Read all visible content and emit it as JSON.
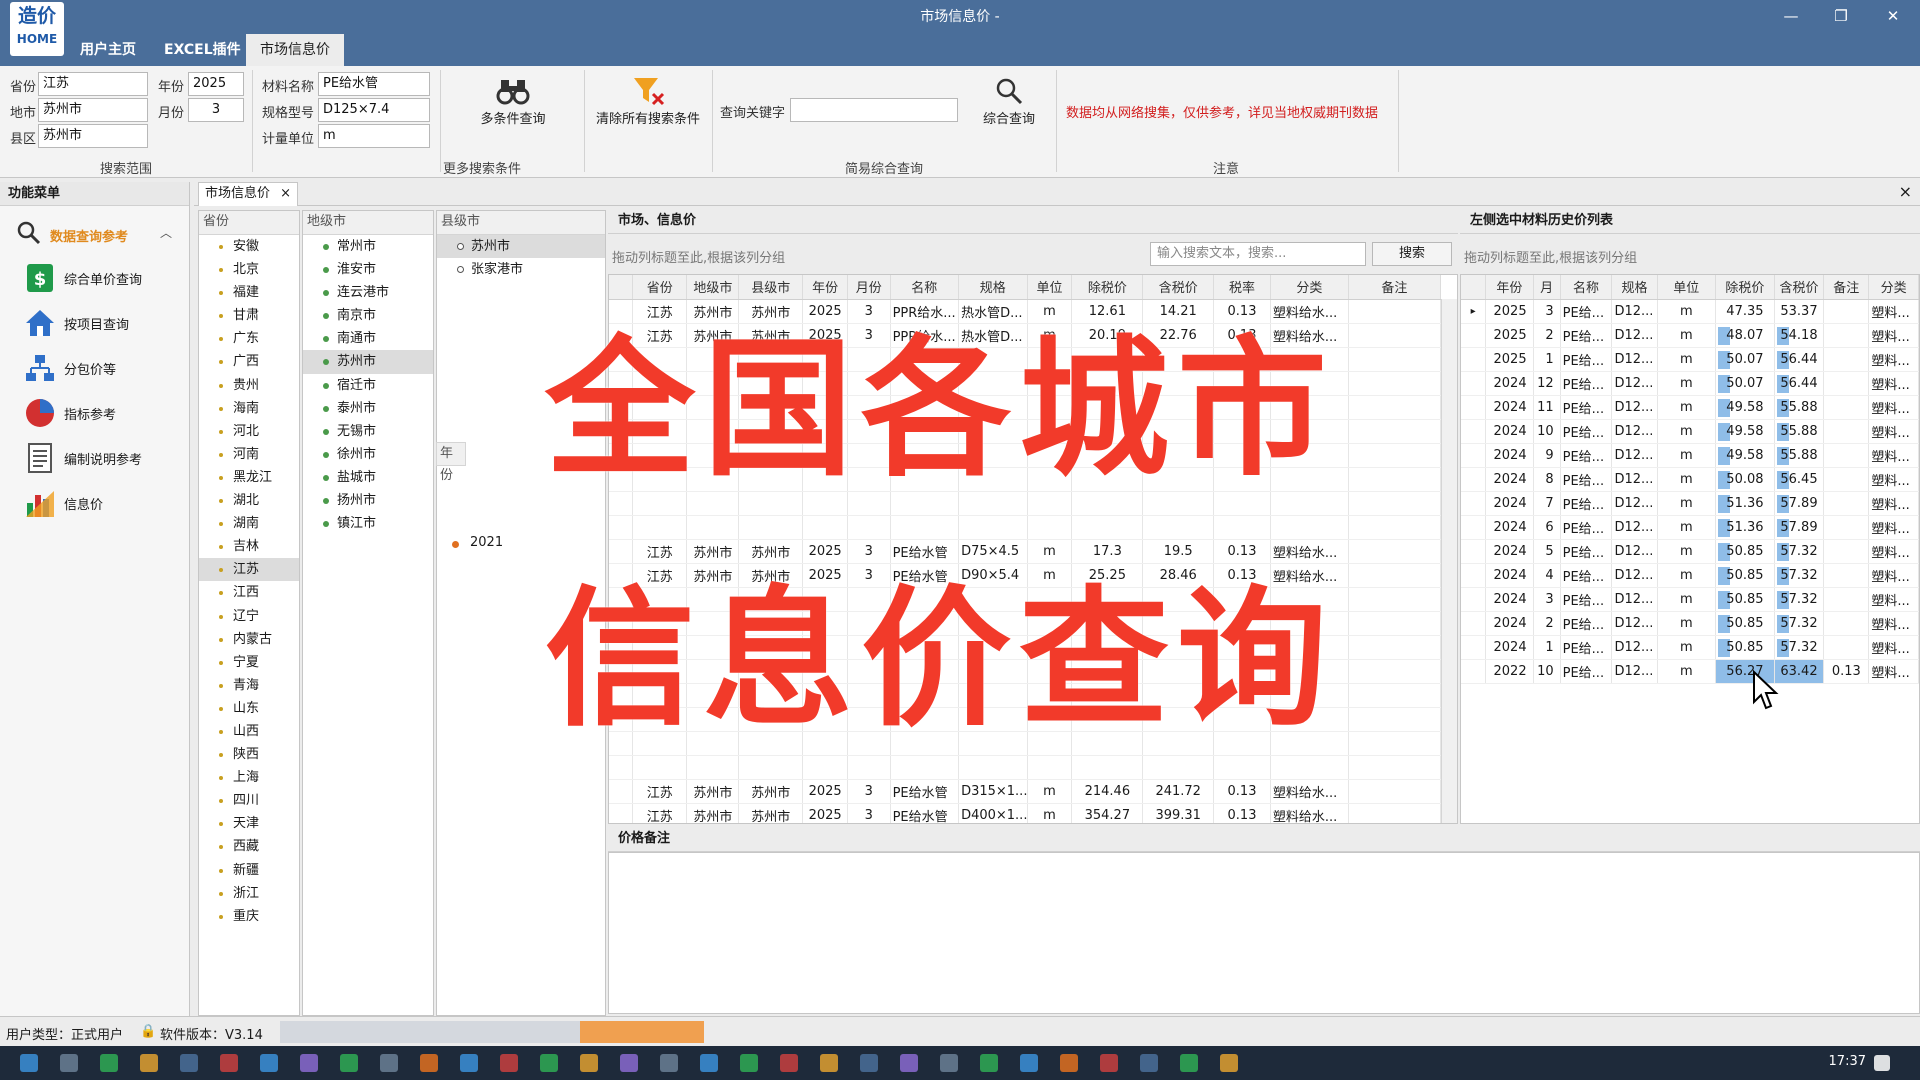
{
  "window": {
    "title": "市场信息价 -",
    "logo_line1": "造价",
    "logo_line2": "HOME",
    "min": "—",
    "max": "❐",
    "close": "✕"
  },
  "top_tabs": [
    "用户主页",
    "EXCEL插件",
    "市场信息价"
  ],
  "ribbon": {
    "province_label": "省份",
    "province_value": "江苏",
    "city_label": "地市",
    "city_value": "苏州市",
    "county_label": "县区",
    "county_value": "苏州市",
    "year_label": "年份",
    "year_value": "2025",
    "month_label": "月份",
    "month_value": "3",
    "material_label": "材料名称",
    "material_value": "PE给水管",
    "spec_label": "规格型号",
    "spec_value": "D125×7.4",
    "unit_label": "计量单位",
    "unit_value": "m",
    "multi_search": "多条件查询",
    "clear_all": "清除所有搜索条件",
    "keyword_label": "查询关键字",
    "keyword_value": "",
    "combined_search": "综合查询",
    "notice": "数据均从网络搜集，仅供参考，详见当地权威期刊数据",
    "group_scope": "搜索范围",
    "group_more": "更多搜索条件",
    "group_simple": "简易综合查询",
    "group_note": "注意"
  },
  "sidebar": {
    "title": "功能菜单",
    "section": "数据查询参考",
    "items": [
      "综合单价查询",
      "按项目查询",
      "分包价等",
      "指标参考",
      "编制说明参考",
      "信息价"
    ]
  },
  "doc_tab": {
    "label": "市场信息价",
    "close": "×",
    "panel_close": "×"
  },
  "province_panel": {
    "header": "省份",
    "items": [
      "安徽",
      "北京",
      "福建",
      "甘肃",
      "广东",
      "广西",
      "贵州",
      "海南",
      "河北",
      "河南",
      "黑龙江",
      "湖北",
      "湖南",
      "吉林",
      "江苏",
      "江西",
      "辽宁",
      "内蒙古",
      "宁夏",
      "青海",
      "山东",
      "山西",
      "陕西",
      "上海",
      "四川",
      "天津",
      "西藏",
      "新疆",
      "浙江",
      "重庆"
    ],
    "selected": "江苏"
  },
  "city_panel": {
    "header": "地级市",
    "items": [
      "常州市",
      "淮安市",
      "连云港市",
      "南京市",
      "南通市",
      "苏州市",
      "宿迁市",
      "泰州市",
      "无锡市",
      "徐州市",
      "盐城市",
      "扬州市",
      "镇江市"
    ],
    "selected": "苏州市"
  },
  "county_panel": {
    "header": "县级市",
    "items": [
      "苏州市",
      "张家港市"
    ],
    "selected": "苏州市",
    "year_header": "年份",
    "year_item": "2021"
  },
  "main_grid": {
    "section_title": "市场、信息价",
    "group_hint": "拖动列标题至此,根据该列分组",
    "search_placeholder": "输入搜索文本，搜索...",
    "search_button": "搜索",
    "columns": [
      "省份",
      "地级市",
      "县级市",
      "年份",
      "月份",
      "名称",
      "规格",
      "单位",
      "除税价",
      "含税价",
      "税率",
      "分类",
      "备注"
    ],
    "rows": [
      [
        "江苏",
        "苏州市",
        "苏州市",
        "2025",
        "3",
        "PPR给水...",
        "热水管D...",
        "m",
        "12.61",
        "14.21",
        "0.13",
        "塑料给水...",
        ""
      ],
      [
        "江苏",
        "苏州市",
        "苏州市",
        "2025",
        "3",
        "PPR给水...",
        "热水管D...",
        "m",
        "20.19",
        "22.76",
        "0.13",
        "塑料给水...",
        ""
      ],
      [
        "江苏",
        "苏州市",
        "苏州市",
        "2025",
        "3",
        "PE给水管",
        "D75×4.5",
        "m",
        "17.3",
        "19.5",
        "0.13",
        "塑料给水...",
        ""
      ],
      [
        "江苏",
        "苏州市",
        "苏州市",
        "2025",
        "3",
        "PE给水管",
        "D90×5.4",
        "m",
        "25.25",
        "28.46",
        "0.13",
        "塑料给水...",
        ""
      ],
      [
        "江苏",
        "苏州市",
        "苏州市",
        "2025",
        "3",
        "PE给水管",
        "D315×1...",
        "m",
        "214.46",
        "241.72",
        "0.13",
        "塑料给水...",
        ""
      ],
      [
        "江苏",
        "苏州市",
        "苏州市",
        "2025",
        "3",
        "PE给水管",
        "D400×1...",
        "m",
        "354.27",
        "399.31",
        "0.13",
        "塑料给水...",
        ""
      ]
    ],
    "notes_title": "价格备注"
  },
  "history_grid": {
    "section_title": "左侧选中材料历史价列表",
    "group_hint": "拖动列标题至此,根据该列分组",
    "columns": [
      "年份",
      "月",
      "名称",
      "规格",
      "单位",
      "除税价",
      "含税价",
      "备注",
      "分类"
    ],
    "rows": [
      [
        "2025",
        "3",
        "PE给...",
        "D12...",
        "m",
        "47.35",
        "53.37",
        "",
        "塑料..."
      ],
      [
        "2025",
        "2",
        "PE给...",
        "D12...",
        "m",
        "48.07",
        "54.18",
        "",
        "塑料..."
      ],
      [
        "2025",
        "1",
        "PE给...",
        "D12...",
        "m",
        "50.07",
        "56.44",
        "",
        "塑料..."
      ],
      [
        "2024",
        "12",
        "PE给...",
        "D12...",
        "m",
        "50.07",
        "56.44",
        "",
        "塑料..."
      ],
      [
        "2024",
        "11",
        "PE给...",
        "D12...",
        "m",
        "49.58",
        "55.88",
        "",
        "塑料..."
      ],
      [
        "2024",
        "10",
        "PE给...",
        "D12...",
        "m",
        "49.58",
        "55.88",
        "",
        "塑料..."
      ],
      [
        "2024",
        "9",
        "PE给...",
        "D12...",
        "m",
        "49.58",
        "55.88",
        "",
        "塑料..."
      ],
      [
        "2024",
        "8",
        "PE给...",
        "D12...",
        "m",
        "50.08",
        "56.45",
        "",
        "塑料..."
      ],
      [
        "2024",
        "7",
        "PE给...",
        "D12...",
        "m",
        "51.36",
        "57.89",
        "",
        "塑料..."
      ],
      [
        "2024",
        "6",
        "PE给...",
        "D12...",
        "m",
        "51.36",
        "57.89",
        "",
        "塑料..."
      ],
      [
        "2024",
        "5",
        "PE给...",
        "D12...",
        "m",
        "50.85",
        "57.32",
        "",
        "塑料..."
      ],
      [
        "2024",
        "4",
        "PE给...",
        "D12...",
        "m",
        "50.85",
        "57.32",
        "",
        "塑料..."
      ],
      [
        "2024",
        "3",
        "PE给...",
        "D12...",
        "m",
        "50.85",
        "57.32",
        "",
        "塑料..."
      ],
      [
        "2024",
        "2",
        "PE给...",
        "D12...",
        "m",
        "50.85",
        "57.32",
        "",
        "塑料..."
      ],
      [
        "2024",
        "1",
        "PE给...",
        "D12...",
        "m",
        "50.85",
        "57.32",
        "",
        "塑料..."
      ],
      [
        "2022",
        "10",
        "PE给...",
        "D12...",
        "m",
        "56.27",
        "63.42",
        "0.13",
        "塑料..."
      ]
    ]
  },
  "overlay": {
    "line1": "全国各城市",
    "line2": "信息价查询"
  },
  "status": {
    "user_type": "用户类型：正式用户",
    "version": "软件版本：V3.14"
  },
  "taskbar": {
    "clock": "17:37"
  },
  "colors": {
    "titlebar": "#4a6e9a",
    "notice": "#d21e1e",
    "overlay": "#f23a2a",
    "highlight": "#8fbde8",
    "section_accent": "#e08a1e"
  }
}
